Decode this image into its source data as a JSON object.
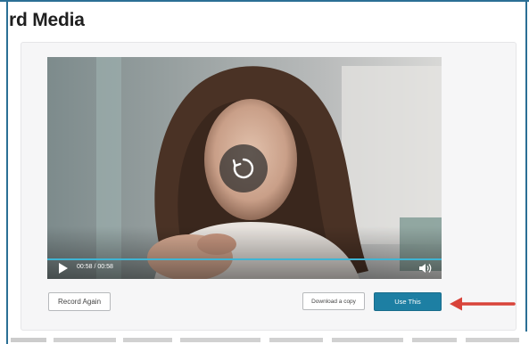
{
  "page": {
    "title": "rd Media"
  },
  "player": {
    "time_display": "00:58 / 00:58",
    "progress_fraction": 1.0
  },
  "actions": {
    "record_again": "Record Again",
    "download": "Download a copy",
    "use_this": "Use This"
  },
  "colors": {
    "accent": "#1d7fa3",
    "progress": "#3fb4d3",
    "callout_arrow": "#d8433a",
    "frame": "#2b6f95"
  },
  "icons": {
    "replay": "replay-icon",
    "play": "play-icon",
    "volume": "volume-icon",
    "callout": "red-arrow-icon"
  }
}
